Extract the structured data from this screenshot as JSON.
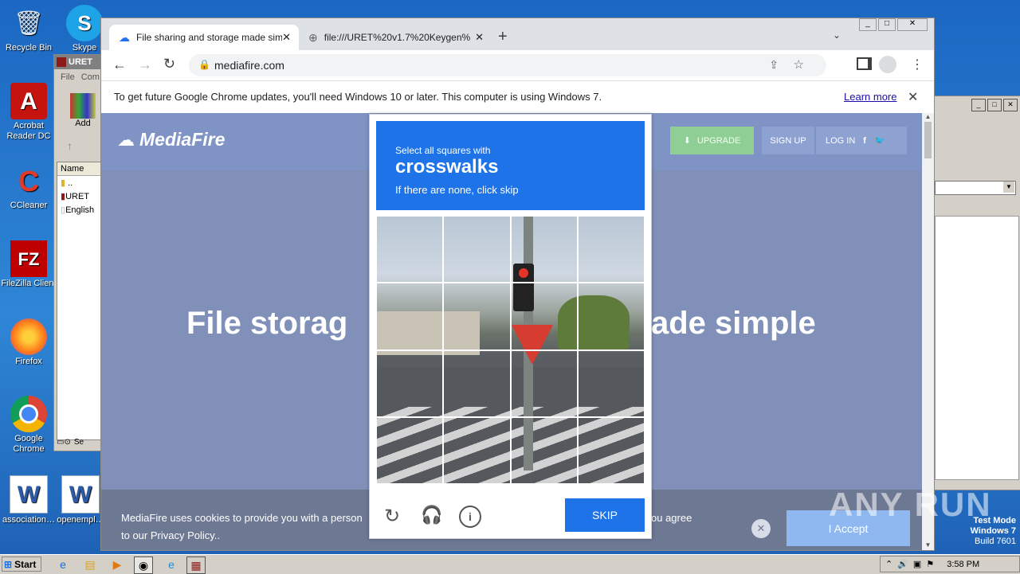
{
  "desktop": {
    "icons": [
      {
        "label": "Recycle Bin",
        "glyph": "🗑"
      },
      {
        "label": "Acrobat Reader DC",
        "glyph": "A"
      },
      {
        "label": "CCleaner",
        "glyph": "C"
      },
      {
        "label": "FileZilla Client",
        "glyph": "FZ"
      },
      {
        "label": "Firefox",
        "glyph": "🦊"
      },
      {
        "label": "Google Chrome",
        "glyph": "◉"
      },
      {
        "label": "association…",
        "glyph": "W"
      },
      {
        "label": "openempl…",
        "glyph": "W"
      },
      {
        "label": "Skype",
        "glyph": "S"
      }
    ]
  },
  "winrar_window": {
    "title": "URET",
    "menu": [
      "File",
      "Com"
    ],
    "add_label": "Add",
    "column_header": "Name",
    "rows": [
      "..",
      "URET",
      "English"
    ],
    "status_text": "Se"
  },
  "browser": {
    "tabs": [
      {
        "title": "File sharing and storage made simple",
        "active": true
      },
      {
        "title": "file:///URET%20v1.7%20Keygen%…",
        "active": false
      }
    ],
    "address": "mediafire.com",
    "infobar_text": "To get future Google Chrome updates, you'll need Windows 10 or later. This computer is using Windows 7.",
    "infobar_link": "Learn more",
    "colors": {
      "accent": "#1f73e8"
    }
  },
  "mediafire": {
    "logo": "MediaFire",
    "upgrade": "UPGRADE",
    "signup": "SIGN UP",
    "login": "LOG IN",
    "hero_left": "File storag",
    "hero_right": "ade simple",
    "cookie_line1": "MediaFire uses cookies to provide you with a person",
    "cookie_line1_right": "ou agree",
    "cookie_line2": "to our Privacy Policy..",
    "accept": "I Accept"
  },
  "captcha": {
    "prompt_small": "Select all squares with",
    "prompt_target": "crosswalks",
    "prompt_hint": "If there are none, click skip",
    "skip_label": "SKIP"
  },
  "watermark": {
    "brand": "ANY RUN",
    "line1": "Test Mode",
    "line2": "Windows 7",
    "line3": "Build 7601"
  },
  "taskbar": {
    "start": "Start",
    "clock": "3:58 PM"
  }
}
